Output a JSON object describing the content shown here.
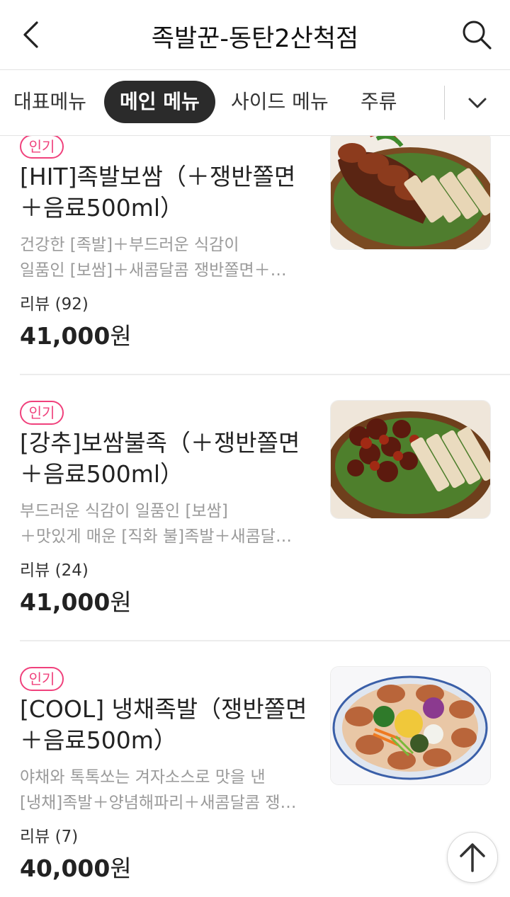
{
  "header": {
    "title": "족발꾼-동탄2산척점",
    "back_icon": "chevron-left-icon",
    "search_icon": "search-icon"
  },
  "tabs": [
    {
      "label": "대표메뉴",
      "active": false
    },
    {
      "label": "메인 메뉴",
      "active": true
    },
    {
      "label": "사이드 메뉴",
      "active": false
    },
    {
      "label": "주류",
      "active": false
    }
  ],
  "tabs_expand_icon": "chevron-down-icon",
  "menu_items": [
    {
      "badge": "인기",
      "name_lines": [
        "[HIT]족발보쌈（＋쟁반쫄면",
        "＋음료500ml）"
      ],
      "desc_lines": [
        "건강한 [족발]＋부드러운 식감이",
        "일품인 [보쌈]＋새콤달콤 쟁반쫄면＋…"
      ],
      "review": "리뷰 (92)",
      "price": "41,000",
      "currency": "원"
    },
    {
      "badge": "인기",
      "name_lines": [
        "[강추]보쌈불족（＋쟁반쫄면",
        "＋음료500ml）"
      ],
      "desc_lines": [
        "부드러운 식감이 일품인 [보쌈]",
        "＋맛있게 매운 [직화 불]족발＋새콤달…"
      ],
      "review": "리뷰 (24)",
      "price": "41,000",
      "currency": "원"
    },
    {
      "badge": "인기",
      "name_lines": [
        "[COOL] 냉채족발（쟁반쫄면",
        "＋음료500m）"
      ],
      "desc_lines": [
        "야채와 톡톡쏘는 겨자소스로 맛을 낸",
        "[냉채]족발＋양념해파리＋새콤달콤 쟁…"
      ],
      "review": "리뷰 (7)",
      "price": "40,000",
      "currency": "원"
    }
  ],
  "scroll_top_icon": "arrow-up-icon",
  "colors": {
    "badge_pink": "#f0417c",
    "active_tab_bg": "#2b2b2b",
    "desc_gray": "#9a9a9a"
  }
}
